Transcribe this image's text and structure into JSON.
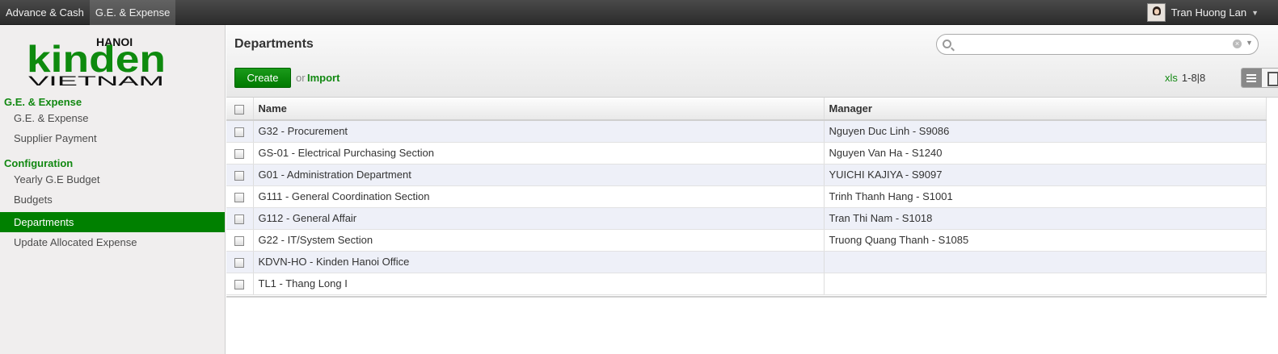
{
  "topbar": {
    "menu": [
      "Advance & Cash",
      "G.E. & Expense"
    ],
    "user_name": "Tran Huong Lan"
  },
  "logo": {
    "word": "kinden",
    "city": "HANOI",
    "country": "VIETNAM"
  },
  "sidebar": {
    "sections": [
      {
        "title": "G.E. & Expense",
        "items": [
          "G.E. & Expense",
          "Supplier Payment"
        ]
      },
      {
        "title": "Configuration",
        "items": [
          "Yearly G.E Budget",
          "Budgets",
          "Departments",
          "Update Allocated Expense"
        ]
      }
    ],
    "active_item": "Departments"
  },
  "header": {
    "title": "Departments",
    "create_label": "Create",
    "or_label": "or",
    "import_label": "Import",
    "xls_label": "xls",
    "pager": "1-8|8",
    "search_placeholder": ""
  },
  "table": {
    "columns": [
      "Name",
      "Manager"
    ],
    "rows": [
      [
        "G32 - Procurement",
        "Nguyen Duc Linh - S9086"
      ],
      [
        "GS-01 - Electrical Purchasing Section",
        "Nguyen Van Ha - S1240"
      ],
      [
        "G01 - Administration Department",
        "YUICHI KAJIYA - S9097"
      ],
      [
        "G111 - General Coordination Section",
        "Trinh Thanh Hang - S1001"
      ],
      [
        "G112 - General Affair",
        "Tran Thi Nam - S1018"
      ],
      [
        "G22 - IT/System Section",
        "Truong Quang Thanh - S1085"
      ],
      [
        "KDVN-HO - Kinden Hanoi Office",
        ""
      ],
      [
        "TL1 - Thang Long I",
        ""
      ]
    ]
  },
  "colors": {
    "accent_green": "#008000",
    "link_green": "#118811",
    "row_stripe": "#eef0f8"
  }
}
